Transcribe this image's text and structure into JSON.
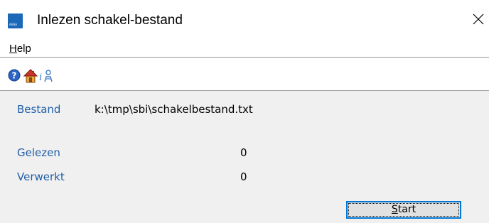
{
  "window": {
    "title": "Inlezen schakel-bestand",
    "app_icon_text": "AENA",
    "close_glyph": "✕"
  },
  "menubar": {
    "items": [
      {
        "label_first": "H",
        "label_rest": "elp"
      }
    ]
  },
  "toolbar": {
    "buttons": [
      {
        "icon": "help-icon"
      },
      {
        "icon": "home-icon"
      },
      {
        "icon": "info-person-icon"
      }
    ]
  },
  "fields": {
    "bestand_label": "Bestand",
    "bestand_value": "k:\\tmp\\sbi\\schakelbestand.txt",
    "gelezen_label": "Gelezen",
    "gelezen_value": "0",
    "verwerkt_label": "Verwerkt",
    "verwerkt_value": "0"
  },
  "actions": {
    "start_first": "S",
    "start_rest": "tart"
  },
  "colors": {
    "label_blue": "#1f5ea8",
    "focus_border": "#0078d7",
    "app_icon": "#1b68b8"
  }
}
